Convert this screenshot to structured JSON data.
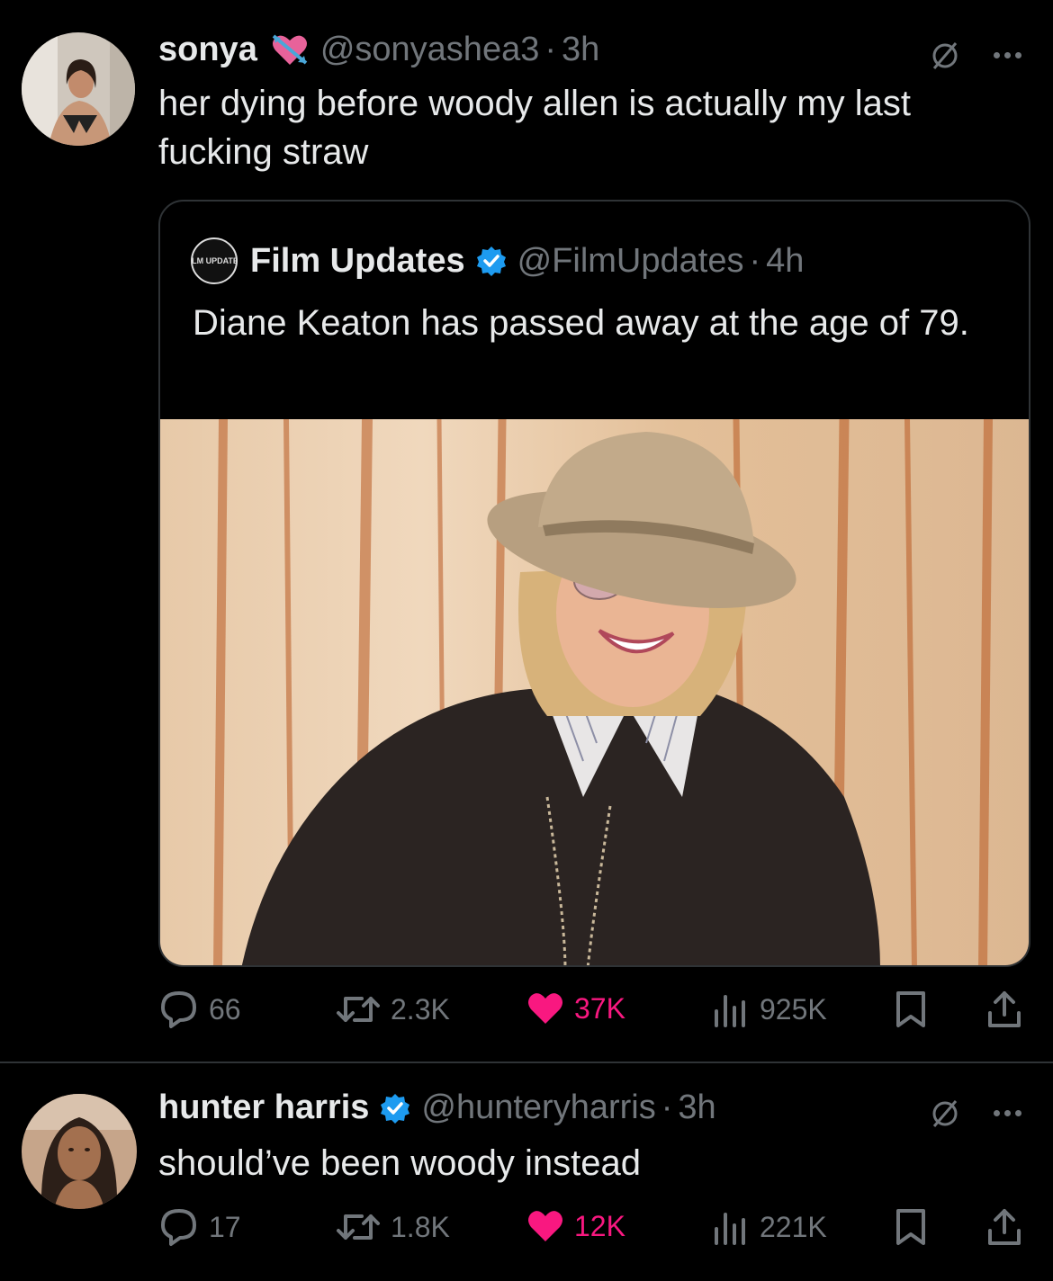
{
  "tweets": [
    {
      "author": {
        "name": "sonya",
        "handle": "@sonyashea3",
        "time": "3h",
        "badge_emoji": "heart-with-arrow-icon",
        "verified": false
      },
      "text": "her dying before woody allen is actually my last fucking straw",
      "quote": {
        "author": {
          "name": "Film Updates",
          "handle": "@FilmUpdates",
          "time": "4h",
          "verified": true,
          "avatar_text": "FILM UPDATES"
        },
        "text": "Diane Keaton has passed away at the age of 79.",
        "media": "photo"
      },
      "stats": {
        "replies": "66",
        "retweets": "2.3K",
        "likes": "37K",
        "views": "925K",
        "liked": true
      }
    },
    {
      "author": {
        "name": "hunter harris",
        "handle": "@hunteryharris",
        "time": "3h",
        "verified": true
      },
      "text": "should’ve been woody instead",
      "stats": {
        "replies": "17",
        "retweets": "1.8K",
        "likes": "12K",
        "views": "221K",
        "liked": true
      }
    }
  ],
  "colors": {
    "background": "#000000",
    "text": "#e7e9ea",
    "muted": "#71767b",
    "like": "#f91880",
    "verified": "#1d9bf0",
    "border": "#2f3336"
  }
}
